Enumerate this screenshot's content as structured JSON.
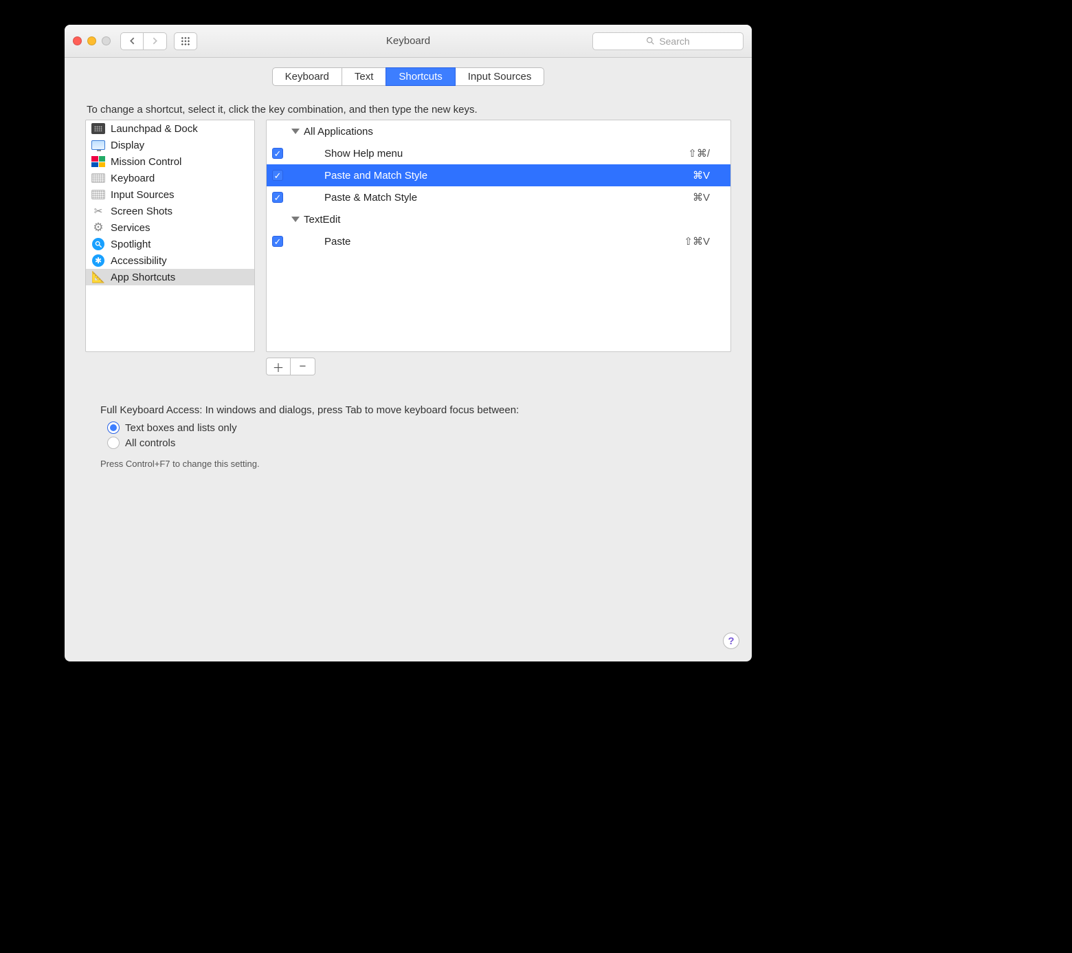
{
  "window": {
    "title": "Keyboard"
  },
  "search": {
    "placeholder": "Search"
  },
  "tabs": [
    "Keyboard",
    "Text",
    "Shortcuts",
    "Input Sources"
  ],
  "tabs_active_index": 2,
  "instruction": "To change a shortcut, select it, click the key combination, and then type the new keys.",
  "categories": [
    {
      "label": "Launchpad & Dock",
      "icon": "launchpad"
    },
    {
      "label": "Display",
      "icon": "display"
    },
    {
      "label": "Mission Control",
      "icon": "mission"
    },
    {
      "label": "Keyboard",
      "icon": "keyboard"
    },
    {
      "label": "Input Sources",
      "icon": "keyboard"
    },
    {
      "label": "Screen Shots",
      "icon": "scissors"
    },
    {
      "label": "Services",
      "icon": "gear"
    },
    {
      "label": "Spotlight",
      "icon": "spotlight"
    },
    {
      "label": "Accessibility",
      "icon": "accessibility"
    },
    {
      "label": "App Shortcuts",
      "icon": "app"
    }
  ],
  "categories_selected_index": 9,
  "tree": [
    {
      "type": "group",
      "label": "All Applications"
    },
    {
      "type": "item",
      "checked": true,
      "label": "Show Help menu",
      "keys": "⇧⌘/"
    },
    {
      "type": "item",
      "checked": true,
      "label": "Paste and Match Style",
      "keys": "⌘V",
      "selected": true
    },
    {
      "type": "item",
      "checked": true,
      "label": "Paste & Match Style",
      "keys": "⌘V"
    },
    {
      "type": "group",
      "label": "TextEdit"
    },
    {
      "type": "item",
      "checked": true,
      "label": "Paste",
      "keys": "⇧⌘V"
    }
  ],
  "buttons": {
    "plus": "＋",
    "minus": "−"
  },
  "fka_label": "Full Keyboard Access: In windows and dialogs, press Tab to move keyboard focus between:",
  "fka_options": [
    "Text boxes and lists only",
    "All controls"
  ],
  "fka_selected_index": 0,
  "fka_hint": "Press Control+F7 to change this setting.",
  "help": "?"
}
